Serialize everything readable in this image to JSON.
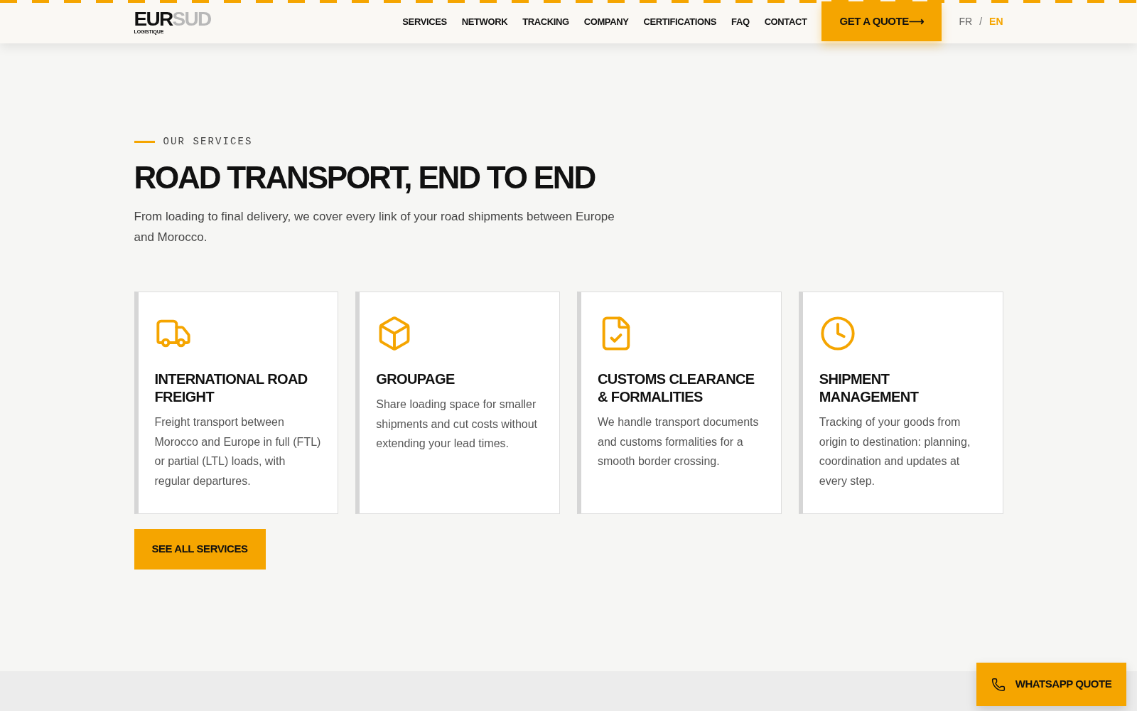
{
  "logo": {
    "main": "EUR",
    "accent": "SUD",
    "tagline": "LOGISTIQUE"
  },
  "nav": [
    "SERVICES",
    "NETWORK",
    "TRACKING",
    "COMPANY",
    "CERTIFICATIONS",
    "FAQ",
    "CONTACT"
  ],
  "quote_button": "GET A QUOTE⟶",
  "languages": [
    {
      "label": "FR",
      "selected": false
    },
    {
      "label": "EN",
      "selected": true
    }
  ],
  "language_separator": "/",
  "section": {
    "eyebrow": "OUR SERVICES",
    "title": "ROAD TRANSPORT, END TO END",
    "intro": "From loading to final delivery, we cover every link of your road shipments between Europe and Morocco."
  },
  "cards": [
    {
      "title": "INTERNATIONAL ROAD FREIGHT",
      "text": "Freight transport between Morocco and Europe in full (FTL) or partial (LTL) loads, with regular departures."
    },
    {
      "title": "GROUPAGE",
      "text": "Share loading space for smaller shipments and cut costs without extending your lead times."
    },
    {
      "title": "CUSTOMS CLEARANCE & FORMALITIES",
      "text": "We handle transport documents and customs formalities for a smooth border crossing."
    },
    {
      "title": "SHIPMENT MANAGEMENT",
      "text": "Tracking of your goods from origin to destination: planning, coordination and updates at every step."
    }
  ],
  "all_services_button": "SEE ALL SERVICES",
  "whatsapp_button": "WHATSAPP QUOTE"
}
